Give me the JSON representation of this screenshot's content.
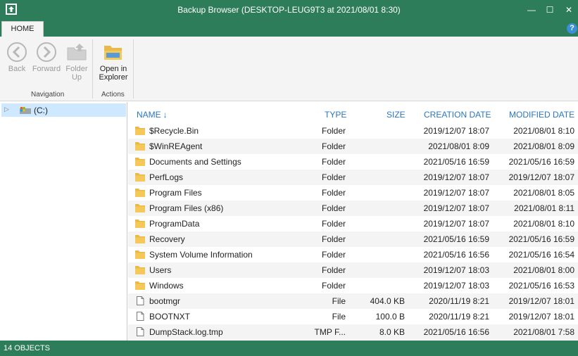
{
  "window": {
    "title": "Backup Browser (DESKTOP-LEUG9T3 at 2021/08/01 8:30)",
    "min_glyph": "—",
    "max_glyph": "☐",
    "close_glyph": "✕"
  },
  "ribbon": {
    "tab_home": "HOME",
    "help_glyph": "?",
    "back_label": "Back",
    "forward_label": "Forward",
    "folder_up_label": "Folder Up",
    "open_in_explorer_label": "Open in Explorer",
    "group_navigation": "Navigation",
    "group_actions": "Actions"
  },
  "tree": {
    "arrow_glyph": "▷",
    "root_label": "(C:)"
  },
  "columns": {
    "name": "NAME",
    "name_sort_glyph": "↓",
    "type": "TYPE",
    "size": "SIZE",
    "creation_date": "CREATION DATE",
    "modified_date": "MODIFIED DATE"
  },
  "rows": [
    {
      "icon": "folder-icon",
      "name": "$Recycle.Bin",
      "type": "Folder",
      "size": "",
      "created": "2019/12/07 18:07",
      "modified": "2021/08/01 8:10"
    },
    {
      "icon": "folder-icon",
      "name": "$WinREAgent",
      "type": "Folder",
      "size": "",
      "created": "2021/08/01 8:09",
      "modified": "2021/08/01 8:09"
    },
    {
      "icon": "folder-icon",
      "name": "Documents and Settings",
      "type": "Folder",
      "size": "",
      "created": "2021/05/16 16:59",
      "modified": "2021/05/16 16:59"
    },
    {
      "icon": "folder-icon",
      "name": "PerfLogs",
      "type": "Folder",
      "size": "",
      "created": "2019/12/07 18:07",
      "modified": "2019/12/07 18:07"
    },
    {
      "icon": "folder-icon",
      "name": "Program Files",
      "type": "Folder",
      "size": "",
      "created": "2019/12/07 18:07",
      "modified": "2021/08/01 8:05"
    },
    {
      "icon": "folder-icon",
      "name": "Program Files (x86)",
      "type": "Folder",
      "size": "",
      "created": "2019/12/07 18:07",
      "modified": "2021/08/01 8:11"
    },
    {
      "icon": "folder-icon",
      "name": "ProgramData",
      "type": "Folder",
      "size": "",
      "created": "2019/12/07 18:07",
      "modified": "2021/08/01 8:10"
    },
    {
      "icon": "folder-icon",
      "name": "Recovery",
      "type": "Folder",
      "size": "",
      "created": "2021/05/16 16:59",
      "modified": "2021/05/16 16:59"
    },
    {
      "icon": "folder-icon",
      "name": "System Volume Information",
      "type": "Folder",
      "size": "",
      "created": "2021/05/16 16:56",
      "modified": "2021/05/16 16:54"
    },
    {
      "icon": "folder-icon",
      "name": "Users",
      "type": "Folder",
      "size": "",
      "created": "2019/12/07 18:03",
      "modified": "2021/08/01 8:00"
    },
    {
      "icon": "folder-icon",
      "name": "Windows",
      "type": "Folder",
      "size": "",
      "created": "2019/12/07 18:03",
      "modified": "2021/05/16 16:53"
    },
    {
      "icon": "file-icon",
      "name": "bootmgr",
      "type": "File",
      "size": "404.0 KB",
      "created": "2020/11/19 8:21",
      "modified": "2019/12/07 18:01"
    },
    {
      "icon": "file-icon",
      "name": "BOOTNXT",
      "type": "File",
      "size": "100.0 B",
      "created": "2020/11/19 8:21",
      "modified": "2019/12/07 18:01"
    },
    {
      "icon": "file-icon",
      "name": "DumpStack.log.tmp",
      "type": "TMP F...",
      "size": "8.0 KB",
      "created": "2021/05/16 16:56",
      "modified": "2021/08/01 7:58"
    }
  ],
  "status": {
    "text": "14 OBJECTS"
  },
  "colors": {
    "accent_green": "#2e7d5a",
    "header_blue": "#2b76c0",
    "selection": "#cde8ff",
    "folder_yellow": "#e9b949"
  }
}
